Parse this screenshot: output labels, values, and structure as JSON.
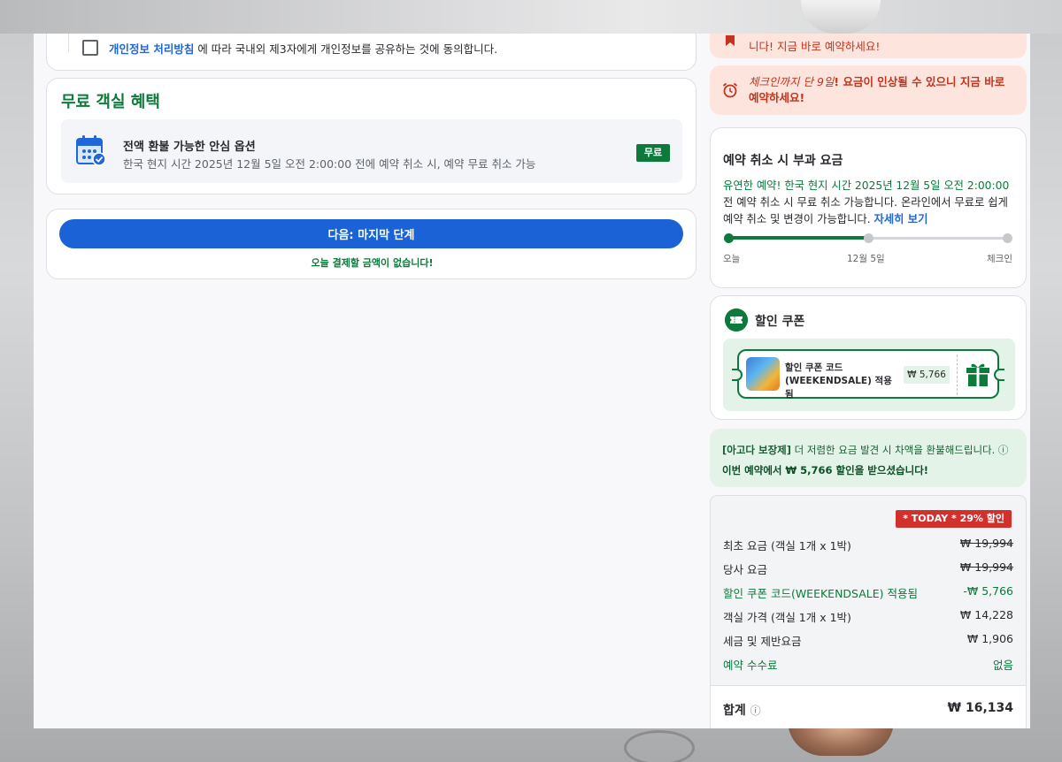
{
  "consent": {
    "link": "개인정보 처리방침",
    "text": " 에 따라 국내외 제3자에게 개인정보를 공유하는 것에 동의합니다."
  },
  "benefit": {
    "title": "무료 객실 혜택",
    "name": "전액 환불 가능한 안심 옵션",
    "desc": "한국 현지 시간 2025년 12월 5일 오전 2:00:00 전에 예약 취소 시, 예약 무료 취소 가능",
    "badge": "무료"
  },
  "next": {
    "button": "다음: 마지막 단계",
    "note": "오늘 결제할 금액이 없습니다!"
  },
  "alerts": {
    "top": "니다! 지금 바로 예약하세요!",
    "checkin_prefix": "체크인까지 단 9일",
    "checkin_suffix": "! 요금이 인상될 수 있으니 지금 바로 예약하세요!"
  },
  "cancellation": {
    "title": "예약 취소 시 부과 요금",
    "desc_green": "유연한 예약! 한국 현지 시간 2025년 12월 5일 오전 2:00:00",
    "desc_rest": " 전 예약 취소 시 무료 취소 가능합니다. 온라인에서 무료로 쉽게 예약 취소 및 변경이 가능합니다. ",
    "more": "자세히 보기",
    "timeline": [
      "오늘",
      "12월 5일",
      "체크인"
    ]
  },
  "coupon": {
    "title": "할인 쿠폰",
    "name": "할인 쿠폰 코드 (WEEKENDSALE) 적용됨",
    "amount": "₩ 5,766"
  },
  "guarantee": {
    "label": "[아고다 보장제]",
    "text": " 더 저렴한 요금 발견 시 차액을 환불해드립니다. ⓘ",
    "saved": "이번 예약에서 ₩ 5,766 할인을 받으셨습니다!"
  },
  "price": {
    "badge": "* TODAY * 29% 할인",
    "rows": [
      {
        "label": "최초 요금 (객실 1개 x 1박)",
        "value": "₩ 19,994"
      },
      {
        "label": "당사 요금",
        "value": "₩ 19,994"
      },
      {
        "label": "할인 쿠폰 코드(WEEKENDSALE) 적용됨",
        "value": "-₩ 5,766"
      },
      {
        "label": "객실 가격 (객실 1개 x 1박)",
        "value": "₩ 14,228"
      },
      {
        "label": "세금 및 제반요금",
        "value": "₩ 1,906"
      },
      {
        "label": "예약 수수료",
        "value": "없음"
      }
    ],
    "total_label": "합계",
    "total_value": "₩ 16,134"
  },
  "colors": {
    "primary_blue": "#1a62d6",
    "green": "#0b7a3b",
    "alert_red": "#c2341e",
    "today_badge": "#d1302c"
  }
}
